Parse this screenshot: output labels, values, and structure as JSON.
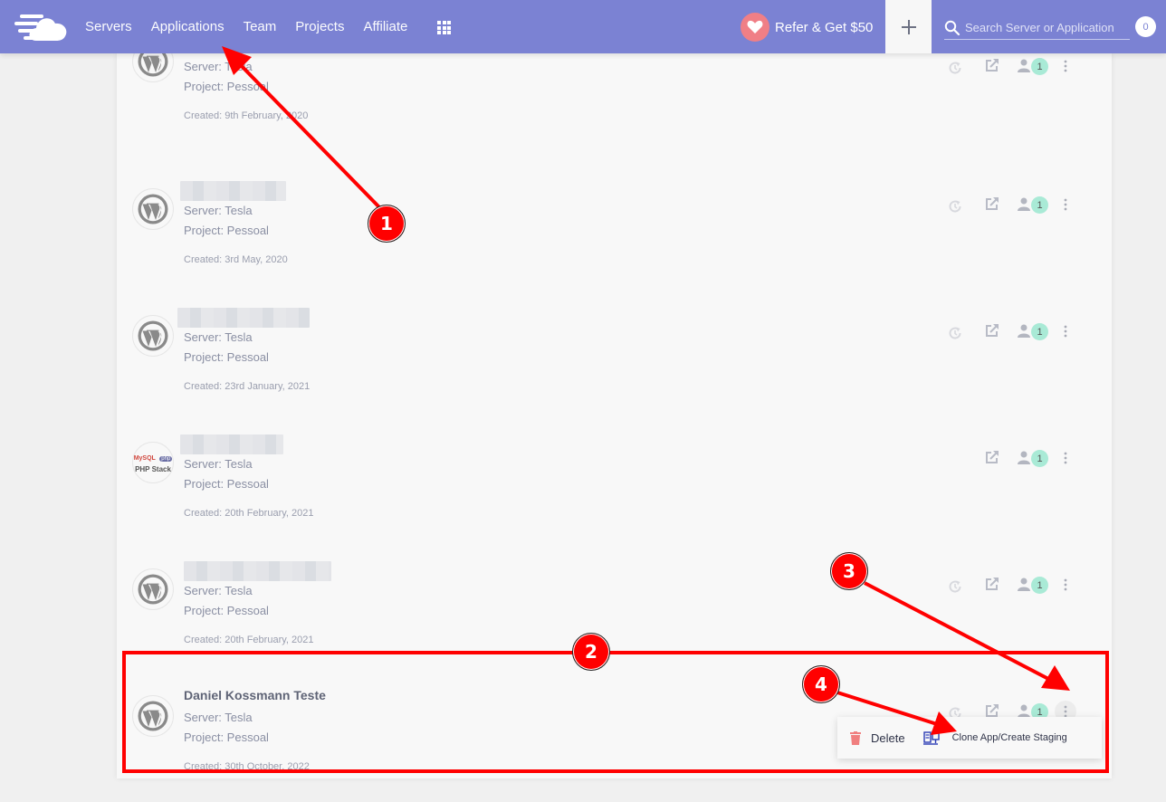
{
  "topbar": {
    "nav": [
      "Servers",
      "Applications",
      "Team",
      "Projects",
      "Affiliate"
    ],
    "refer_label": "Refer & Get $50",
    "search_placeholder": "Search Server or Application",
    "notification_count": "0",
    "colors": {
      "bar": "#7b82d3",
      "heart": "#f07f86"
    }
  },
  "applications": [
    {
      "name": "",
      "name_hidden": true,
      "icon": "wordpress",
      "server": "Server: Tesla",
      "project": "Project: Pessoal",
      "created": "Created: 9th February, 2020",
      "has_restore": true,
      "collaborators": "1"
    },
    {
      "name": "",
      "name_hidden": true,
      "icon": "wordpress",
      "server": "Server: Tesla",
      "project": "Project: Pessoal",
      "created": "Created: 3rd May, 2020",
      "has_restore": true,
      "collaborators": "1"
    },
    {
      "name": "",
      "name_hidden": true,
      "icon": "wordpress",
      "server": "Server: Tesla",
      "project": "Project: Pessoal",
      "created": "Created: 23rd January, 2021",
      "has_restore": true,
      "collaborators": "1"
    },
    {
      "name": "",
      "name_hidden": true,
      "icon": "php-stack",
      "server": "Server: Tesla",
      "project": "Project: Pessoal",
      "created": "Created: 20th February, 2021",
      "has_restore": false,
      "collaborators": "1"
    },
    {
      "name": "",
      "name_hidden": true,
      "icon": "wordpress",
      "server": "Server: Tesla",
      "project": "Project: Pessoal",
      "created": "Created: 20th February, 2021",
      "has_restore": true,
      "collaborators": "1"
    },
    {
      "name": "Daniel Kossmann Teste",
      "name_hidden": false,
      "icon": "wordpress",
      "server": "Server: Tesla",
      "project": "Project: Pessoal",
      "created": "Created: 30th October, 2022",
      "has_restore": true,
      "collaborators": "1",
      "menu_open": true
    }
  ],
  "php_stack_icon": {
    "line1a": "MySQL",
    "line1b": "php",
    "line2": "PHP Stack"
  },
  "dropdown": {
    "delete_label": "Delete",
    "clone_label": "Clone App/Create Staging"
  },
  "annotations": {
    "markers": [
      "1",
      "2",
      "3",
      "4"
    ],
    "color": "#ff0000"
  }
}
